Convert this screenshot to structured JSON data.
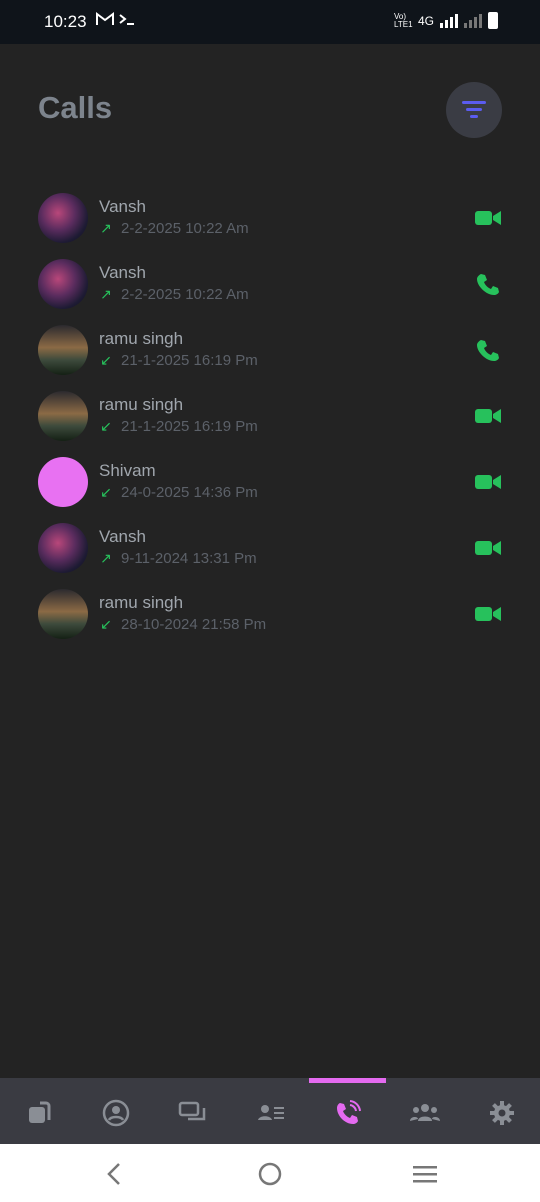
{
  "status_bar": {
    "time": "10:23",
    "left_icons": [
      "gmail-icon",
      "terminal-icon"
    ],
    "network_label": "Vo) LTE1",
    "network_type": "4G"
  },
  "header": {
    "title": "Calls",
    "filter_icon": "filter-icon"
  },
  "calls": [
    {
      "name": "Vansh",
      "direction": "outgoing",
      "arrow": "↗",
      "datetime": "2-2-2025 10:22 Am",
      "type": "video",
      "avatar": "a1"
    },
    {
      "name": "Vansh",
      "direction": "outgoing",
      "arrow": "↗",
      "datetime": "2-2-2025 10:22 Am",
      "type": "voice",
      "avatar": "a1"
    },
    {
      "name": "ramu singh",
      "direction": "incoming",
      "arrow": "↙",
      "datetime": "21-1-2025 16:19 Pm",
      "type": "voice",
      "avatar": "a2"
    },
    {
      "name": "ramu singh",
      "direction": "incoming",
      "arrow": "↙",
      "datetime": "21-1-2025 16:19 Pm",
      "type": "video",
      "avatar": "a2"
    },
    {
      "name": "Shivam",
      "direction": "incoming",
      "arrow": "↙",
      "datetime": "24-0-2025 14:36 Pm",
      "type": "video",
      "avatar": "a3"
    },
    {
      "name": "Vansh",
      "direction": "outgoing",
      "arrow": "↗",
      "datetime": "9-11-2024 13:31 Pm",
      "type": "video",
      "avatar": "a1"
    },
    {
      "name": "ramu singh",
      "direction": "incoming",
      "arrow": "↙",
      "datetime": "28-10-2024 21:58 Pm",
      "type": "video",
      "avatar": "a2"
    }
  ],
  "bottom_nav": {
    "items": [
      "stories-icon",
      "profile-icon",
      "chats-icon",
      "contacts-icon",
      "calls-icon",
      "groups-icon",
      "settings-icon"
    ],
    "active": "calls-icon"
  },
  "colors": {
    "background": "#232323",
    "accent": "#e46af0",
    "call_green": "#27c15c",
    "filter_icon": "#5b5cf0"
  }
}
